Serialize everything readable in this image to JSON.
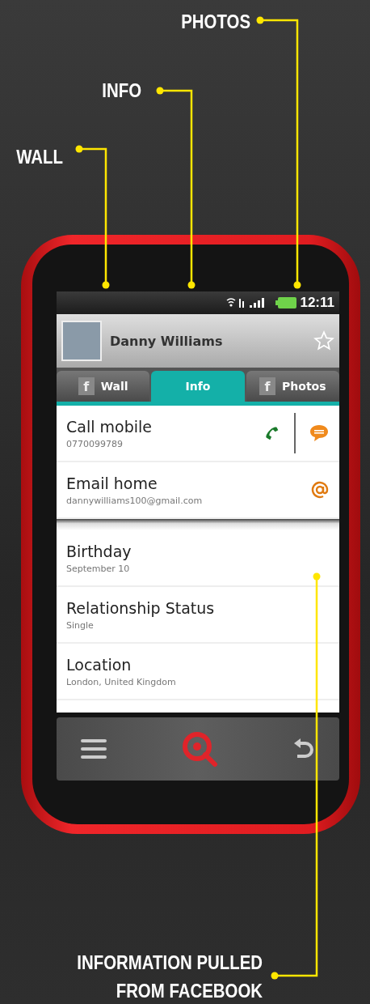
{
  "callouts": [
    {
      "label": "PHOTOS"
    },
    {
      "label": "INFO"
    },
    {
      "label": "WALL"
    },
    {
      "label": "INFORMATION PULLED FROM FACEBOOK"
    }
  ],
  "status_bar": {
    "time": "12:11"
  },
  "contact": {
    "name": "Danny Williams",
    "starred": false
  },
  "tabs": [
    {
      "label": "Wall",
      "badge": "f",
      "selected": false
    },
    {
      "label": "Info",
      "selected": true
    },
    {
      "label": "Photos",
      "badge": "f",
      "selected": false
    }
  ],
  "actions": [
    {
      "kind": "call",
      "title": "Call mobile",
      "value": "0770099789"
    },
    {
      "kind": "email",
      "title": "Email home",
      "value": "dannywilliams100@gmail.com"
    }
  ],
  "details": [
    {
      "title": "Birthday",
      "value": "September 10"
    },
    {
      "title": "Relationship Status",
      "value": "Single"
    },
    {
      "title": "Location",
      "value": "London, United Kingdom"
    }
  ]
}
